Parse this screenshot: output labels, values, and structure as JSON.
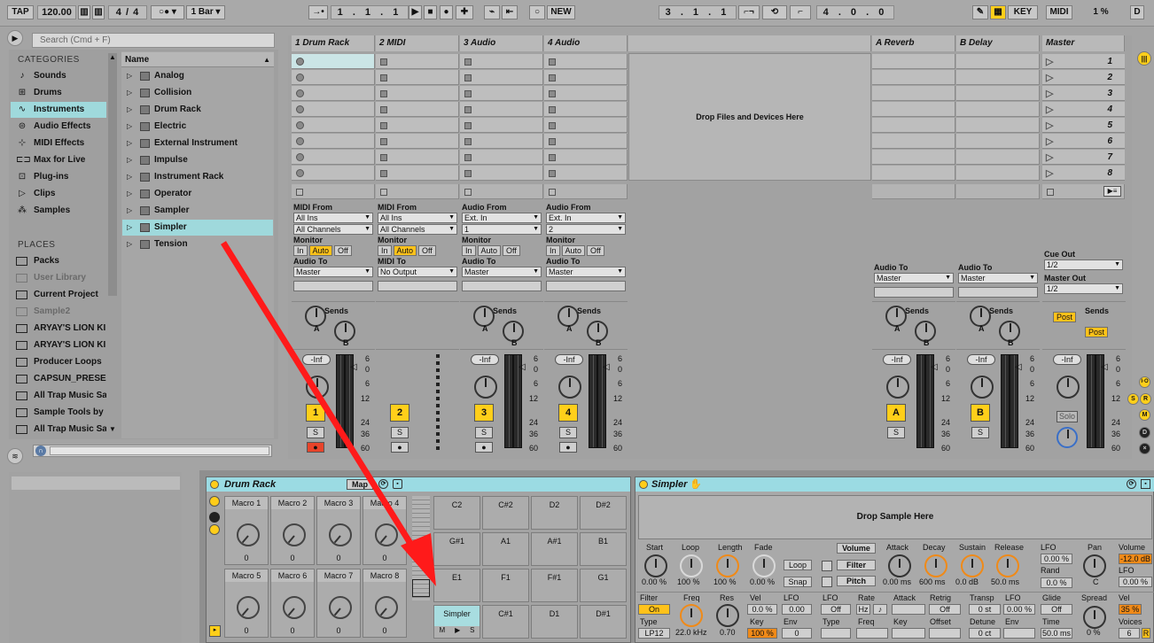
{
  "topbar": {
    "tap": "TAP",
    "tempo": "120.00",
    "sig": "4 / 4",
    "metro": "1 Bar",
    "pos": "1 . 1 . 1",
    "new": "NEW",
    "loopstart": "3 . 1 . 1",
    "looplen": "4 . 0 . 0",
    "key": "KEY",
    "midi": "MIDI",
    "cpu": "1 %",
    "d": "D"
  },
  "browser": {
    "search_placeholder": "Search (Cmd + F)",
    "categories_title": "CATEGORIES",
    "places_title": "PLACES",
    "name_header": "Name",
    "categories": [
      "Sounds",
      "Drums",
      "Instruments",
      "Audio Effects",
      "MIDI Effects",
      "Max for Live",
      "Plug-ins",
      "Clips",
      "Samples"
    ],
    "places": [
      "Packs",
      "User Library",
      "Current Project",
      "Sample2",
      "ARYAY'S LION KI",
      "ARYAY'S LION KI",
      "Producer Loops",
      "CAPSUN_PRESE",
      "All Trap Music Sa",
      "Sample Tools by",
      "All Trap Music Sa"
    ],
    "items": [
      "Analog",
      "Collision",
      "Drum Rack",
      "Electric",
      "External Instrument",
      "Impulse",
      "Instrument Rack",
      "Operator",
      "Sampler",
      "Simpler",
      "Tension"
    ]
  },
  "session": {
    "tracks": [
      "1 Drum Rack",
      "2 MIDI",
      "3 Audio",
      "4 Audio"
    ],
    "returns": [
      "A Reverb",
      "B Delay"
    ],
    "master": "Master",
    "drop": "Drop Files and Devices Here",
    "scenes": [
      "1",
      "2",
      "3",
      "4",
      "5",
      "6",
      "7",
      "8"
    ],
    "io": {
      "midi_from": "MIDI From",
      "audio_from": "Audio From",
      "all_ins": "All Ins",
      "all_channels": "All Channels",
      "ext_in": "Ext. In",
      "ch1": "1",
      "ch2": "2",
      "monitor": "Monitor",
      "in": "In",
      "auto": "Auto",
      "off": "Off",
      "audio_to": "Audio To",
      "midi_to": "MIDI To",
      "master": "Master",
      "no_output": "No Output",
      "cue_out": "Cue Out",
      "master_out": "Master Out",
      "half": "1/2"
    },
    "sends": "Sends",
    "send_a": "A",
    "send_b": "B",
    "inf": "-Inf",
    "post": "Post",
    "solo": "Solo",
    "s": "S",
    "scale": [
      "6",
      "0",
      "6",
      "12",
      "24",
      "36",
      "60"
    ],
    "track_nums": [
      "1",
      "2",
      "3",
      "4"
    ],
    "return_letters": [
      "A",
      "B"
    ]
  },
  "drumrack": {
    "title": "Drum Rack",
    "map": "Map",
    "macros": [
      {
        "name": "Macro 1",
        "value": "0"
      },
      {
        "name": "Macro 2",
        "value": "0"
      },
      {
        "name": "Macro 3",
        "value": "0"
      },
      {
        "name": "Macro 4",
        "value": "0"
      },
      {
        "name": "Macro 5",
        "value": "0"
      },
      {
        "name": "Macro 6",
        "value": "0"
      },
      {
        "name": "Macro 7",
        "value": "0"
      },
      {
        "name": "Macro 8",
        "value": "0"
      }
    ],
    "pads": [
      "C2",
      "C#2",
      "D2",
      "D#2",
      "G#1",
      "A1",
      "A#1",
      "B1",
      "E1",
      "F1",
      "F#1",
      "G1",
      "Simpler",
      "C#1",
      "D1",
      "D#1"
    ],
    "m": "M",
    "s": "S"
  },
  "simpler": {
    "title": "Simpler",
    "drop": "Drop Sample Here",
    "params": [
      {
        "label": "Start",
        "value": "0.00 %"
      },
      {
        "label": "Loop",
        "value": "100 %"
      },
      {
        "label": "Length",
        "value": "100 %"
      },
      {
        "label": "Fade",
        "value": "0.00 %"
      }
    ],
    "loop": "Loop",
    "snap": "Snap",
    "volume": "Volume",
    "filter": "Filter",
    "pitch": "Pitch",
    "env": [
      {
        "label": "Attack",
        "value": "0.00 ms"
      },
      {
        "label": "Decay",
        "value": "600 ms"
      },
      {
        "label": "Sustain",
        "value": "0.0 dB"
      },
      {
        "label": "Release",
        "value": "50.0 ms"
      }
    ],
    "lfo": "LFO",
    "lfo_val": "0.00 %",
    "rand": "Rand",
    "rand_val": "0.0 %",
    "pan": "Pan",
    "pan_val": "C",
    "vol": "Volume",
    "vol_val": "-12.0 dB",
    "vol_lfo": "LFO",
    "vol_lfo_val": "0.00 %",
    "filter_label": "Filter",
    "filter_on": "On",
    "freq": "Freq",
    "freq_val": "22.0 kHz",
    "res": "Res",
    "res_val": "0.70",
    "vel": "Vel",
    "vel_val": "0.0 %",
    "lfo2": "LFO",
    "lfo2_val": "0.00",
    "type": "Type",
    "type_val": "LP12",
    "key": "Key",
    "key_val": "100 %",
    "envl": "Env",
    "env_val": "0",
    "lfo3": "LFO",
    "lfo3_val": "Off",
    "rate": "Rate",
    "hz": "Hz",
    "attack": "Attack",
    "retrig": "Retrig",
    "retrig_val": "Off",
    "type2": "Type",
    "freq2": "Freq",
    "key2": "Key",
    "offset": "Offset",
    "transp": "Transp",
    "transp_val": "0 st",
    "lfo4": "LFO",
    "lfo4_val": "0.00 %",
    "detune": "Detune",
    "detune_val": "0 ct",
    "env2": "Env",
    "glide": "Glide",
    "glide_val": "Off",
    "time": "Time",
    "time_val": "50.0 ms",
    "spread": "Spread",
    "spread_val": "0 %",
    "vel2": "Vel",
    "vel2_val": "35 %",
    "voices": "Voices",
    "voices_val": "6"
  }
}
